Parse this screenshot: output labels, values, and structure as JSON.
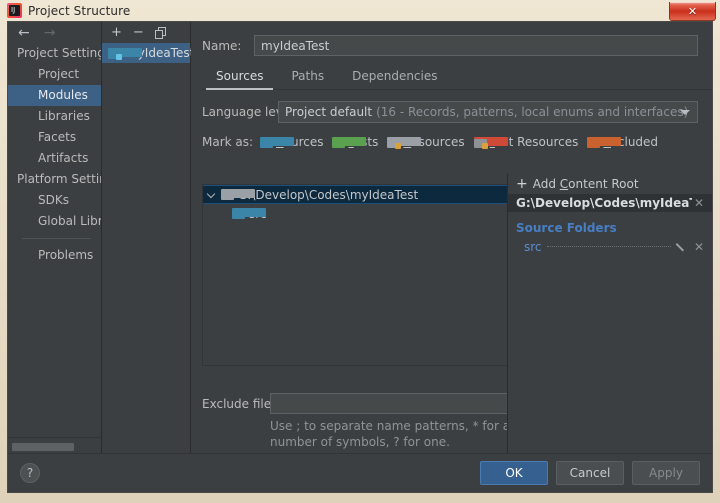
{
  "window": {
    "title": "Project Structure",
    "app_icon": "intellij-idea-icon",
    "close_label": "✕"
  },
  "nav": {
    "back_icon": "←",
    "forward_icon": "→"
  },
  "sidebar": {
    "items": [
      {
        "label": "Project Settings",
        "type": "group",
        "selected": false
      },
      {
        "label": "Project",
        "type": "child",
        "selected": false
      },
      {
        "label": "Modules",
        "type": "child",
        "selected": true
      },
      {
        "label": "Libraries",
        "type": "child",
        "selected": false
      },
      {
        "label": "Facets",
        "type": "child",
        "selected": false
      },
      {
        "label": "Artifacts",
        "type": "child",
        "selected": false
      },
      {
        "label": "Platform Settings",
        "type": "group",
        "selected": false
      },
      {
        "label": "SDKs",
        "type": "child",
        "selected": false
      },
      {
        "label": "Global Libraries",
        "type": "child",
        "selected": false
      }
    ],
    "footer_items": [
      {
        "label": "Problems",
        "type": "child",
        "selected": false
      }
    ]
  },
  "modules_pane": {
    "toolbar": {
      "add_label": "+",
      "remove_label": "−",
      "copy_icon": "copy-icon"
    },
    "items": [
      {
        "label": "myIdeaTest",
        "selected": true,
        "icon": "module-folder-icon"
      }
    ]
  },
  "main": {
    "name_label": "Name:",
    "name_value": "myIdeaTest",
    "name_placeholder": "",
    "tabs": [
      {
        "label": "Sources",
        "active": true
      },
      {
        "label": "Paths",
        "active": false
      },
      {
        "label": "Dependencies",
        "active": false
      }
    ],
    "language_level": {
      "label": "Language level:",
      "value_main": "Project default",
      "value_detail": "(16 - Records, patterns, local enums and interfaces)",
      "caret_icon": "chevron-down-icon"
    },
    "mark_as": {
      "label": "Mark as:",
      "options": [
        {
          "label": "Sources",
          "mnemonic": "S",
          "rest": "ources",
          "color": "#3b86a8",
          "tab_color": "#3b86a8",
          "badge": ""
        },
        {
          "label": "Tests",
          "mnemonic": "T",
          "rest": "ests",
          "color": "#59a14f",
          "tab_color": "#59a14f",
          "badge": ""
        },
        {
          "label": "Resources",
          "mnemonic": "R",
          "rest": "esources",
          "color": "#9aa0a6",
          "tab_color": "#9aa0a6",
          "badge": "#d8a13a"
        },
        {
          "label": "Test Resources",
          "mnemonic": "T",
          "rest": "est Resources",
          "color": "#8d9296",
          "tab_color": "#cf4b37",
          "badge": "#d8a13a"
        },
        {
          "label": "Excluded",
          "mnemonic": "E",
          "rest": "xcluded",
          "color": "#c9622e",
          "tab_color": "#c9622e",
          "badge": ""
        }
      ]
    },
    "tree": [
      {
        "label": "G:\\Develop\\Codes\\myIdeaTest",
        "level": 0,
        "selected": true,
        "expanded": true,
        "icon": "folder-icon",
        "icon_color": "#9aa0a6"
      },
      {
        "label": "src",
        "level": 1,
        "selected": false,
        "expanded": false,
        "icon": "source-folder-icon",
        "icon_color": "#3b86a8"
      }
    ],
    "exclude": {
      "label": "Exclude files:",
      "value": "",
      "placeholder": "",
      "hint_line1": "Use ; to separate name patterns, * for any",
      "hint_line2": "number of symbols, ? for one."
    }
  },
  "right_panel": {
    "add_content_root": {
      "plus_icon": "+",
      "mnemonic_pre": "Add ",
      "mnemonic": "C",
      "mnemonic_post": "ontent Root"
    },
    "content_root": {
      "path": "G:\\Develop\\Codes\\myIdeaTest",
      "remove_icon": "✕"
    },
    "source_folders": {
      "title": "Source Folders",
      "rows": [
        {
          "name": "src",
          "edit_icon": "pencil-icon",
          "remove_icon": "✕"
        }
      ]
    }
  },
  "bottom": {
    "help_label": "?",
    "buttons": [
      {
        "label": "OK",
        "style": "primary",
        "disabled": false
      },
      {
        "label": "Cancel",
        "style": "normal",
        "disabled": false
      },
      {
        "label": "Apply",
        "style": "normal",
        "disabled": true
      }
    ]
  },
  "colors": {
    "accent": "#3d6185",
    "primary_button": "#36608f",
    "link": "#5b8dd0",
    "heading": "#477ec4",
    "selection_tree": "#0d293e"
  }
}
